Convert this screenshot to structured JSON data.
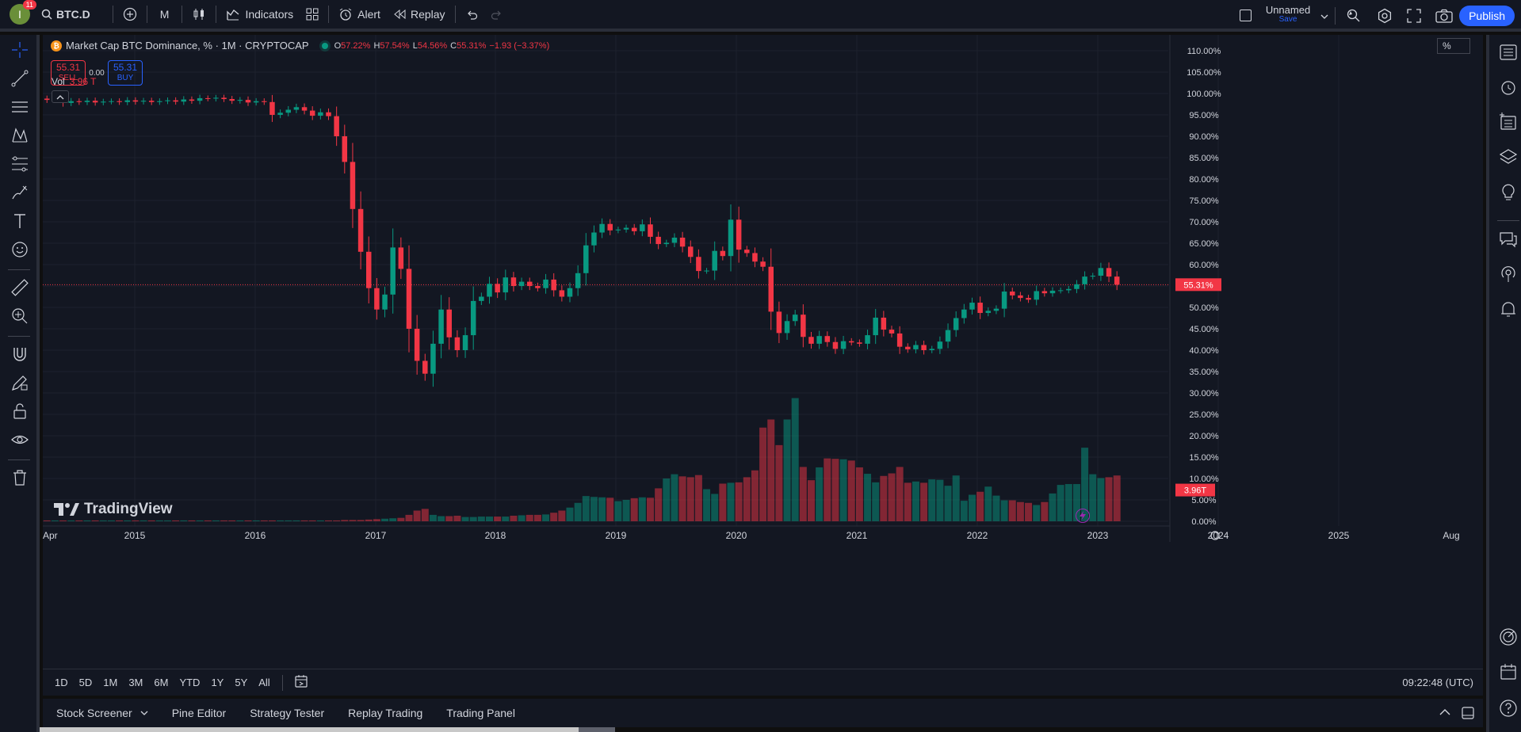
{
  "toolbar": {
    "avatar_letter": "I",
    "notifications": "11",
    "symbol": "BTC.D",
    "interval": "M",
    "indicators_label": "Indicators",
    "alert_label": "Alert",
    "replay_label": "Replay",
    "layout_name": "Unnamed",
    "save_label": "Save",
    "publish_label": "Publish"
  },
  "legend": {
    "coin_letter": "₿",
    "title": "Market Cap BTC Dominance, % · 1M · CRYPTOCAP",
    "o_key": "O",
    "o_val": "57.22%",
    "h_key": "H",
    "h_val": "57.54%",
    "l_key": "L",
    "l_val": "54.56%",
    "c_key": "C",
    "c_val": "55.31%",
    "change": "−1.93 (−3.37%)",
    "sell_price": "55.31",
    "sell_label": "SELL",
    "spread": "0.00",
    "buy_price": "55.31",
    "buy_label": "BUY",
    "vol_label": "Vol",
    "vol_value": "3.96 T"
  },
  "scale_mode": "%",
  "price_tag": "55.31%",
  "vol_tag": "3.96T",
  "watermark": "TradingView",
  "timeframes": [
    "1D",
    "5D",
    "1M",
    "3M",
    "6M",
    "YTD",
    "1Y",
    "5Y",
    "All"
  ],
  "clock": "09:22:48 (UTC)",
  "bottom_tabs": [
    "Stock Screener",
    "Pine Editor",
    "Strategy Tester",
    "Replay Trading",
    "Trading Panel"
  ],
  "colors": {
    "up": "#089981",
    "down": "#f23645",
    "background": "#131722",
    "grid": "#1e222d",
    "accent": "#2962ff"
  },
  "chart_data": {
    "type": "candlestick",
    "title": "Market Cap BTC Dominance, % · 1M · CRYPTOCAP",
    "y_ticks": [
      "110.00%",
      "105.00%",
      "100.00%",
      "95.00%",
      "90.00%",
      "85.00%",
      "80.00%",
      "75.00%",
      "70.00%",
      "65.00%",
      "60.00%",
      "55.00%",
      "50.00%",
      "45.00%",
      "40.00%",
      "35.00%",
      "30.00%",
      "25.00%",
      "20.00%",
      "15.00%",
      "10.00%",
      "5.00%",
      "0.00%"
    ],
    "ylim": [
      0,
      112
    ],
    "x_ticks": [
      "Apr",
      "2015",
      "2016",
      "2017",
      "2018",
      "2019",
      "2020",
      "2021",
      "2022",
      "2023",
      "2024",
      "2025",
      "Aug"
    ],
    "last_close": 55.31,
    "candles_close": [
      98.5,
      98.6,
      97.8,
      98.2,
      98.0,
      98.3,
      97.9,
      98.1,
      98.2,
      98.0,
      98.4,
      98.1,
      98.3,
      98.0,
      98.2,
      98.4,
      98.1,
      98.6,
      98.3,
      98.9,
      98.8,
      99.0,
      98.7,
      98.3,
      98.5,
      97.9,
      98.2,
      98.0,
      95.0,
      95.5,
      96.2,
      96.8,
      96.0,
      94.8,
      95.6,
      94.7,
      90.0,
      84.0,
      73.0,
      63.0,
      54.5,
      49.5,
      53.0,
      64.0,
      59.0,
      45.0,
      37.5,
      34.5,
      41.5,
      49.5,
      43.0,
      40.0,
      43.5,
      51.5,
      52.5,
      55.5,
      53.5,
      57.0,
      55.0,
      56.0,
      55.0,
      54.5,
      56.5,
      54.0,
      52.5,
      54.5,
      58.0,
      64.5,
      67.5,
      69.5,
      68.0,
      68.2,
      68.6,
      67.8,
      69.4,
      66.5,
      64.8,
      65.1,
      66.3,
      64.2,
      61.8,
      58.5,
      58.6,
      63.2,
      62.0,
      70.5,
      63.5,
      62.7,
      60.7,
      59.5,
      49.0,
      44.0,
      46.8,
      48.3,
      43.1,
      41.5,
      43.3,
      41.9,
      40.3,
      42.1,
      41.8,
      41.5,
      43.5,
      47.6,
      44.8,
      43.9,
      40.8,
      40.2,
      41.2,
      40.0,
      40.3,
      42.0,
      44.7,
      47.5,
      49.5,
      51.1,
      48.7,
      49.2,
      49.7,
      53.7,
      52.8,
      52.2,
      51.8,
      53.8,
      53.3,
      53.9,
      54.0,
      54.3,
      55.4,
      57.2,
      57.4,
      59.2,
      57.2,
      55.31
    ],
    "volume_note": "Vol 3.96 T",
    "volume": [
      0.2,
      0.2,
      0.2,
      0.2,
      0.2,
      0.2,
      0.2,
      0.2,
      0.2,
      0.2,
      0.2,
      0.2,
      0.2,
      0.2,
      0.2,
      0.2,
      0.2,
      0.2,
      0.2,
      0.2,
      0.2,
      0.2,
      0.2,
      0.2,
      0.2,
      0.2,
      0.2,
      0.2,
      0.2,
      0.2,
      0.2,
      0.2,
      0.2,
      0.2,
      0.2,
      0.2,
      0.2,
      0.3,
      0.3,
      0.3,
      0.4,
      0.5,
      0.6,
      0.7,
      0.8,
      1.5,
      2.5,
      2.9,
      1.5,
      1.2,
      1.2,
      1.3,
      1.0,
      1.0,
      1.1,
      1.1,
      1.1,
      1.1,
      1.3,
      1.4,
      1.5,
      1.5,
      1.6,
      2.0,
      2.5,
      3.2,
      4.3,
      5.9,
      5.7,
      5.6,
      5.5,
      4.7,
      5.0,
      5.4,
      5.6,
      5.5,
      7.7,
      10.0,
      11.0,
      10.5,
      10.3,
      10.8,
      7.5,
      6.4,
      8.8,
      9.0,
      9.1,
      10.3,
      11.9,
      21.9,
      23.8,
      17.8,
      23.8,
      28.8,
      12.7,
      9.6,
      12.6,
      14.7,
      14.6,
      14.5,
      14.2,
      12.6,
      11.1,
      9.1,
      10.6,
      11.2,
      12.7,
      9.0,
      9.3,
      9.0,
      9.8,
      9.7,
      8.3,
      10.7,
      4.8,
      6.2,
      6.9,
      8.1,
      6.0,
      4.9,
      4.9,
      4.5,
      4.3,
      3.8,
      4.5,
      6.5,
      8.5,
      8.7,
      8.7,
      17.2,
      11.0,
      10.1,
      10.3,
      10.7,
      10.6,
      24.2,
      7.7
    ]
  }
}
